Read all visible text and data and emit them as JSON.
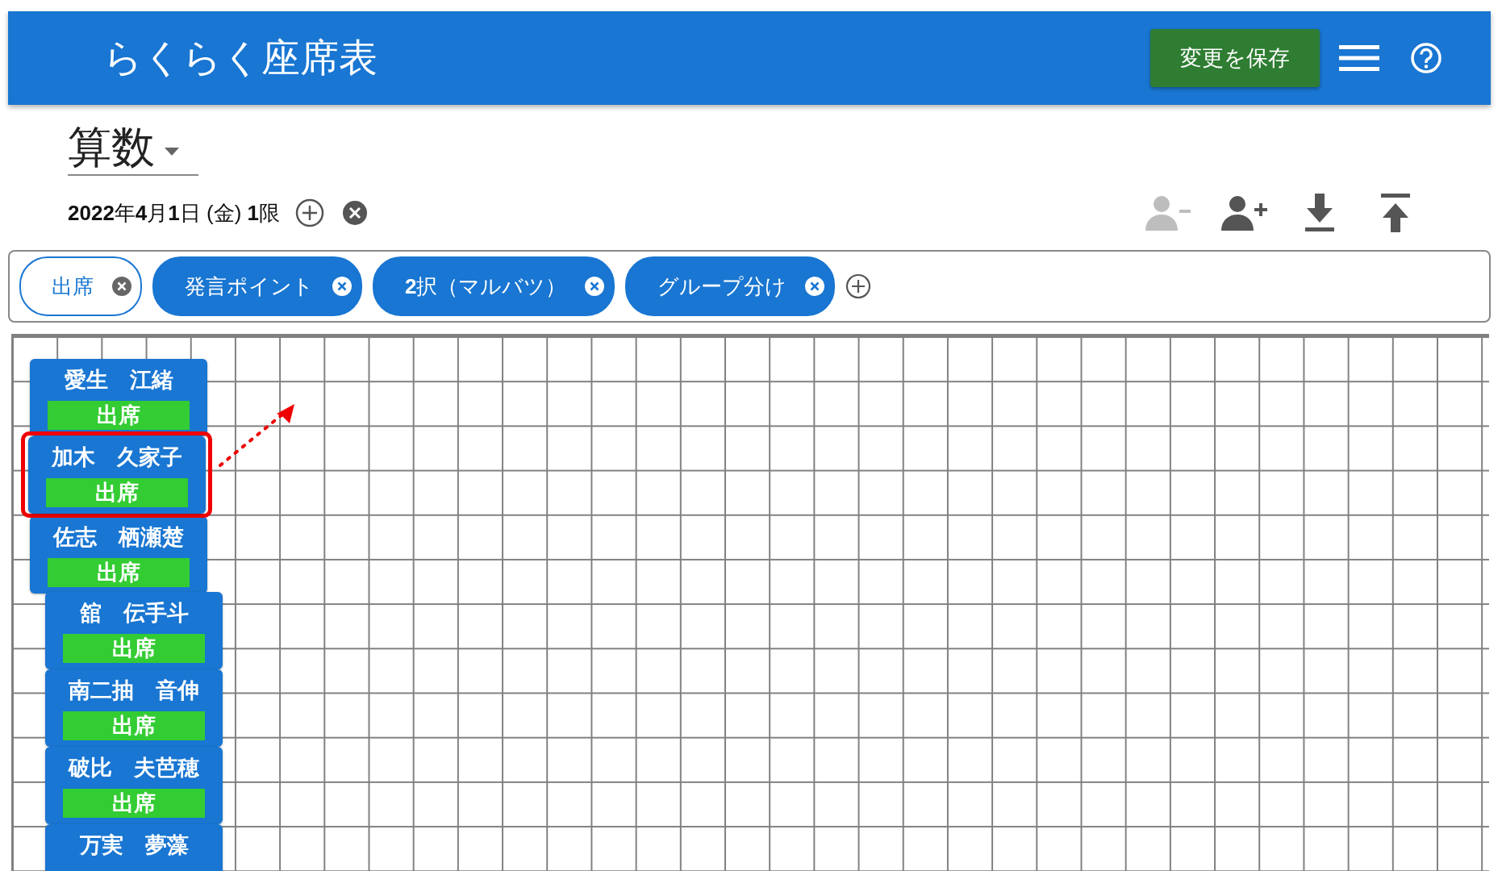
{
  "app_bar": {
    "title": "らくらく座席表",
    "save_button": "変更を保存"
  },
  "subject": {
    "label": "算数"
  },
  "session": {
    "date": "**2022**年**4**月**1**日 (金) **1**限"
  },
  "actions": [
    {
      "kind": "remove-person",
      "disabled": true
    },
    {
      "kind": "add-person",
      "disabled": false
    },
    {
      "kind": "download",
      "disabled": false
    },
    {
      "kind": "upload",
      "disabled": false
    }
  ],
  "tabs": [
    {
      "label": "出席",
      "selected": true
    },
    {
      "label": "発言ポイント",
      "selected": false
    },
    {
      "label": "**2**択（マルバツ）",
      "selected": false
    },
    {
      "label": "グループ分け",
      "selected": false
    }
  ],
  "students": [
    {
      "name": "愛生　江緒",
      "status": "出席",
      "highlighted": false
    },
    {
      "name": "加木　久家子",
      "status": "出席",
      "highlighted": true
    },
    {
      "name": "佐志　栖瀬楚",
      "status": "出席",
      "highlighted": false
    },
    {
      "name": "舘　伝手斗",
      "status": "出席",
      "highlighted": false
    },
    {
      "name": "南二抽　音伸",
      "status": "出席",
      "highlighted": false
    },
    {
      "name": "破比　夫芭穂",
      "status": "出席",
      "highlighted": false
    },
    {
      "name": "万実　夢藻"
    }
  ]
}
